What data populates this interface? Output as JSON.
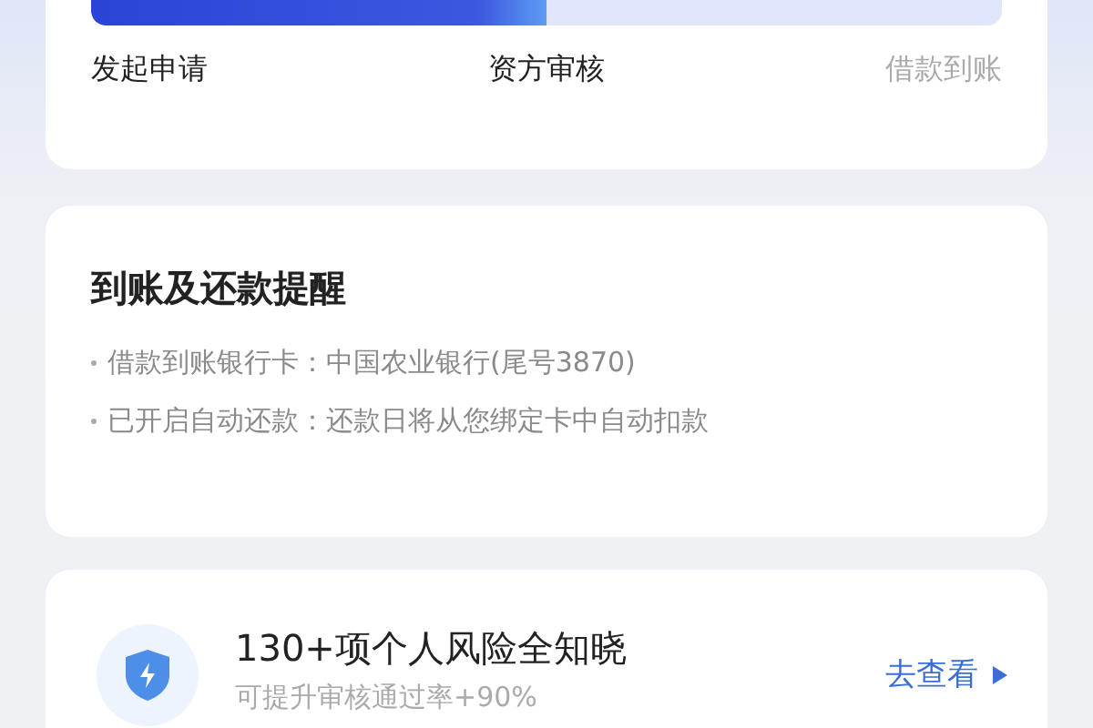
{
  "progress": {
    "level": 0.5,
    "steps": [
      {
        "label": "发起申请",
        "done": true
      },
      {
        "label": "资方审核",
        "done": true
      },
      {
        "label": "借款到账",
        "done": false
      }
    ]
  },
  "reminder": {
    "title": "到账及还款提醒",
    "items": [
      "借款到账银行卡：中国农业银行(尾号3870)",
      "已开启自动还款：还款日将从您绑定卡中自动扣款"
    ]
  },
  "promo": {
    "title": "130+项个人风险全知晓",
    "subtitle": "可提升审核通过率+90%",
    "link": "去查看"
  }
}
